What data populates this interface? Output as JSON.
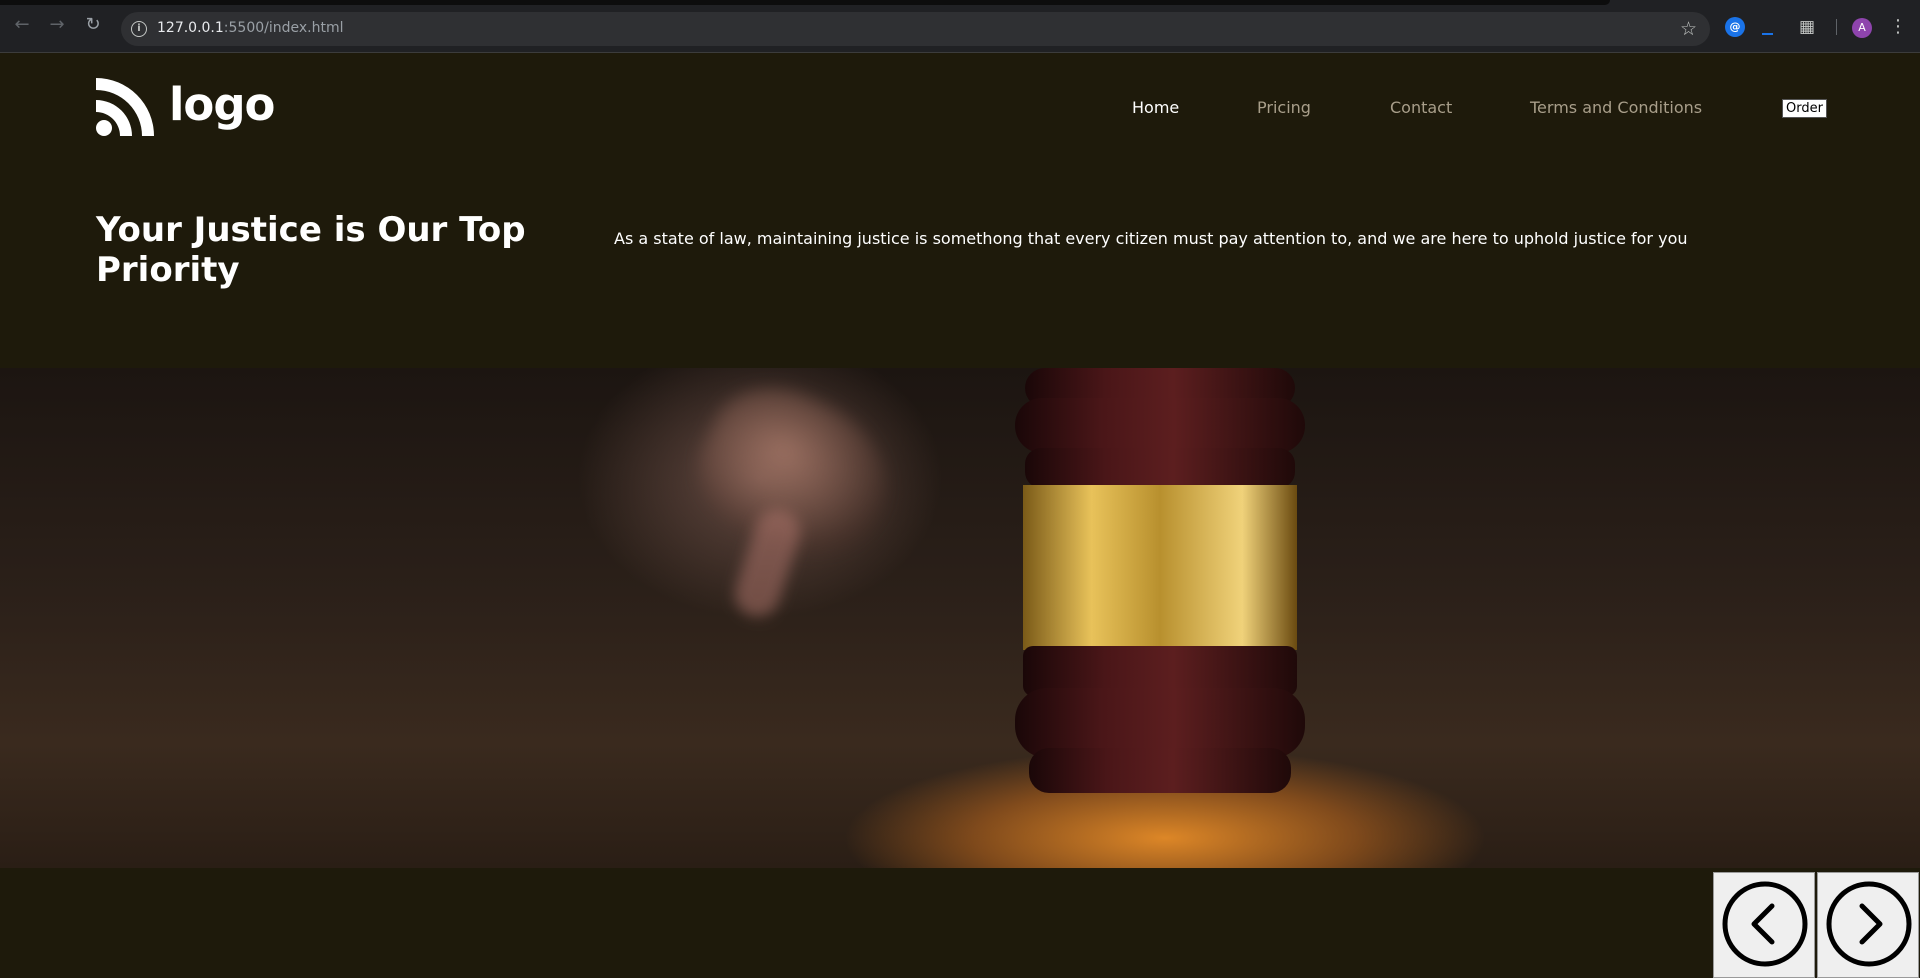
{
  "browser": {
    "url_host": "127.0.0.1",
    "url_path": ":5500/index.html",
    "avatar_letter": "A"
  },
  "site": {
    "logo_text": "logo",
    "nav": {
      "home": "Home",
      "pricing": "Pricing",
      "contact": "Contact",
      "terms": "Terms and Conditions",
      "order": "Order"
    },
    "hero": {
      "title": "Your Justice is Our Top Priority",
      "text": "As a state of law, maintaining justice is somethong that every citizen must pay attention to, and we are here to uphold justice for you"
    }
  },
  "colors": {
    "page_bg": "#1e1a0b",
    "nav_text": "#a89e8a",
    "nav_active": "#ffffff"
  },
  "icons": {
    "back": "arrow-left-icon",
    "forward": "arrow-right-icon",
    "reload": "reload-icon",
    "slider_prev": "chevron-left-icon",
    "slider_next": "chevron-right-icon"
  }
}
